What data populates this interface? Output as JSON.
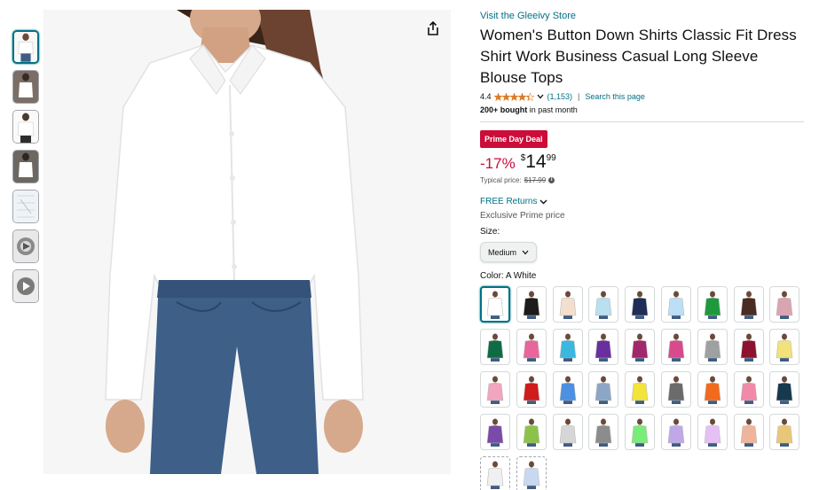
{
  "store": {
    "link_text": "Visit the Gleeivy Store"
  },
  "product": {
    "title": "Women's Button Down Shirts Classic Fit Dress Shirt Work Business Casual Long Sleeve Blouse Tops"
  },
  "rating": {
    "value": "4.4",
    "stars": 4.4,
    "count": "(1,153)",
    "separator": "|",
    "search_link": "Search this page"
  },
  "bought": {
    "bold": "200+ bought",
    "rest": " in past month"
  },
  "deal": {
    "badge": "Prime Day Deal",
    "discount": "-17%",
    "currency": "$",
    "whole": "14",
    "fraction": "99"
  },
  "typical": {
    "label": "Typical price:",
    "value": "$17.99"
  },
  "returns": {
    "label": "FREE Returns"
  },
  "exclusive": {
    "text": "Exclusive Prime price"
  },
  "size": {
    "label": "Size:",
    "selected": "Medium"
  },
  "color": {
    "label": "Color:",
    "selected": "A White",
    "swatches": [
      "#ffffff",
      "#1c1c1c",
      "#f2dfcd",
      "#b8e0ee",
      "#1f2d57",
      "#bcdff5",
      "#1e9a3d",
      "#4a2c23",
      "#d9a5b1",
      "#0f6b46",
      "#e8669b",
      "#3ab8e0",
      "#6a2f9e",
      "#a3276c",
      "#d94a8c",
      "#9ea0a1",
      "#8c1230",
      "#f2e27a",
      "#f2a5bf",
      "#cf1c1c",
      "#4d8fe0",
      "#8ea6c6",
      "#f2e43a",
      "#6b6b6b",
      "#f26a1c",
      "#f08aa8",
      "#16394d",
      "#7a4aa8",
      "#8bc34a",
      "#d6d6d6",
      "#8c8c8c",
      "#7aec7a",
      "#c0a8e8",
      "#e6c0f5",
      "#f0b49a",
      "#e8c878",
      "#f0f0f0",
      "#c8d8f0"
    ]
  },
  "colors": {
    "link": "#007185",
    "deal_red": "#cc0c39",
    "star": "#de7921",
    "selected_border": "#007185"
  }
}
